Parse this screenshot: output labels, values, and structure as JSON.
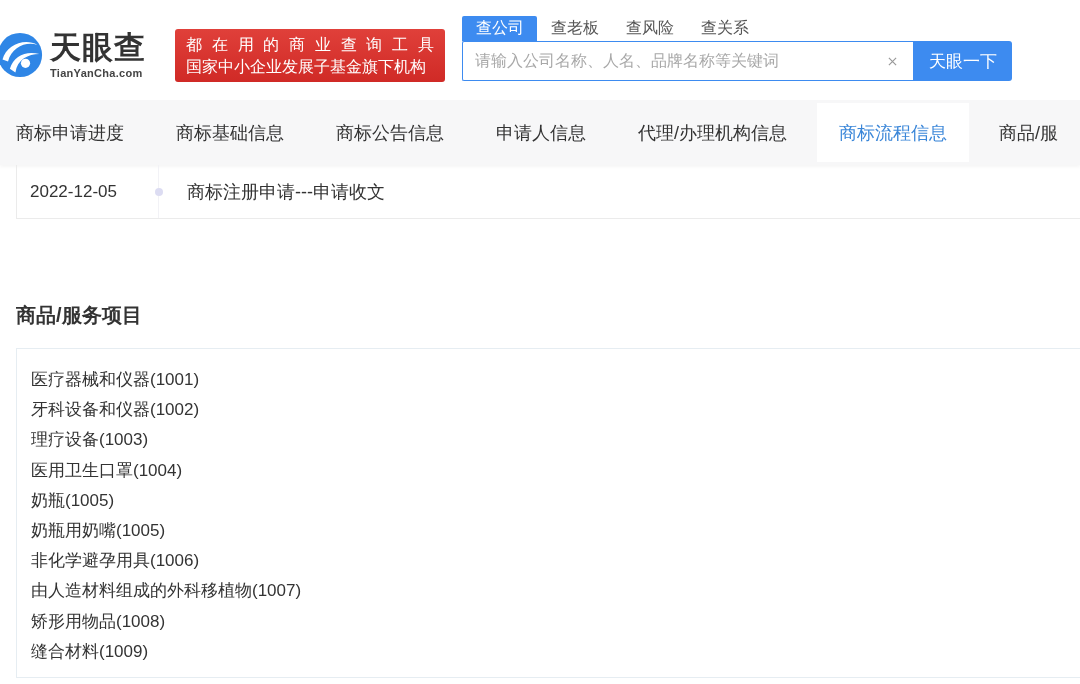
{
  "header": {
    "logo": {
      "wordmark": "天眼查",
      "domain": "TianYanCha.com"
    },
    "banner": {
      "lines": [
        "都在用的商业查询工具",
        "国家中小企业发展子基金旗下机构"
      ]
    },
    "search": {
      "tabs": [
        {
          "label": "查公司",
          "selected": true
        },
        {
          "label": "查老板",
          "selected": false
        },
        {
          "label": "查风险",
          "selected": false
        },
        {
          "label": "查关系",
          "selected": false
        }
      ],
      "placeholder": "请输入公司名称、人名、品牌名称等关键词",
      "button": "天眼一下"
    }
  },
  "nav_tabs": [
    {
      "label": "商标申请进度",
      "selected": false
    },
    {
      "label": "商标基础信息",
      "selected": false
    },
    {
      "label": "商标公告信息",
      "selected": false
    },
    {
      "label": "申请人信息",
      "selected": false
    },
    {
      "label": "代理/办理机构信息",
      "selected": false
    },
    {
      "label": "商标流程信息",
      "selected": true
    },
    {
      "label": "商品/服",
      "selected": false
    }
  ],
  "timeline": [
    {
      "date": "2022-12-05",
      "event": "商标注册申请---申请收文"
    }
  ],
  "goods_services": {
    "title": "商品/服务项目",
    "items": [
      "医疗器械和仪器(1001)",
      "牙科设备和仪器(1002)",
      "理疗设备(1003)",
      "医用卫生口罩(1004)",
      "奶瓶(1005)",
      "奶瓶用奶嘴(1005)",
      "非化学避孕用具(1006)",
      "由人造材料组成的外科移植物(1007)",
      "矫形用物品(1008)",
      "缝合材料(1009)"
    ]
  }
}
